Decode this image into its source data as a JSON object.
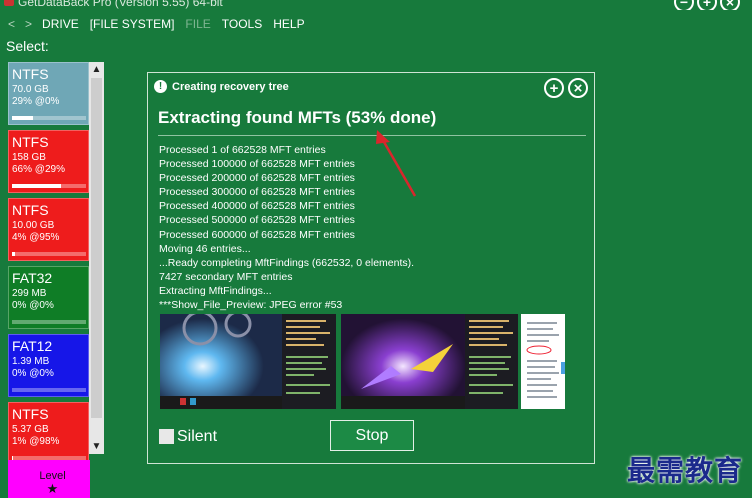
{
  "app": {
    "title": "GetDataBack Pro (Version 5.55) 64-bit",
    "window_buttons": [
      "−",
      "+",
      "×"
    ]
  },
  "menu": {
    "back": "<",
    "forward": ">",
    "items": [
      {
        "label": "DRIVE",
        "enabled": true
      },
      {
        "label": "[FILE SYSTEM]",
        "enabled": true
      },
      {
        "label": "FILE",
        "enabled": false
      },
      {
        "label": "TOOLS",
        "enabled": true
      },
      {
        "label": "HELP",
        "enabled": true
      }
    ]
  },
  "select_label": "Select:",
  "drives": [
    {
      "fs": "NTFS",
      "size": "70.0 GB",
      "usage": "29% @0%",
      "color": "#6fa7b6",
      "used": 0.29
    },
    {
      "fs": "NTFS",
      "size": "158 GB",
      "usage": "66% @29%",
      "color": "#ee1c1c",
      "used": 0.66
    },
    {
      "fs": "NTFS",
      "size": "10.00 GB",
      "usage": "4% @95%",
      "color": "#ee1c1c",
      "used": 0.04
    },
    {
      "fs": "FAT32",
      "size": "299 MB",
      "usage": "0% @0%",
      "color": "#0f7d26",
      "used": 0.0
    },
    {
      "fs": "FAT12",
      "size": "1.39 MB",
      "usage": "0% @0%",
      "color": "#1616e8",
      "used": 0.0
    },
    {
      "fs": "NTFS",
      "size": "5.37 GB",
      "usage": "1% @98%",
      "color": "#ee1c1c",
      "used": 0.01
    }
  ],
  "level_tile": {
    "label": "Level",
    "icon": "star-icon"
  },
  "dialog": {
    "header": "Creating recovery tree",
    "heading": "Extracting found MFTs (53% done)",
    "progress_percent": 53,
    "log": [
      "Processed 1 of 662528 MFT entries",
      "Processed 100000 of 662528 MFT entries",
      "Processed 200000 of 662528 MFT entries",
      "Processed 300000 of 662528 MFT entries",
      "Processed 400000 of 662528 MFT entries",
      "Processed 500000 of 662528 MFT entries",
      "Processed 600000 of 662528 MFT entries",
      "Moving 46 entries...",
      "...Ready completing MftFindings (662532, 0 elements).",
      "7427 secondary MFT entries",
      "Extracting MftFindings...",
      "***Show_File_Preview: JPEG error #53"
    ],
    "silent_label": "Silent",
    "stop_label": "Stop",
    "buttons": {
      "add": "+",
      "close": "×"
    }
  },
  "watermark": "最需教育",
  "colors": {
    "background": "#177a3c",
    "annotation_arrow": "#d9262c"
  }
}
